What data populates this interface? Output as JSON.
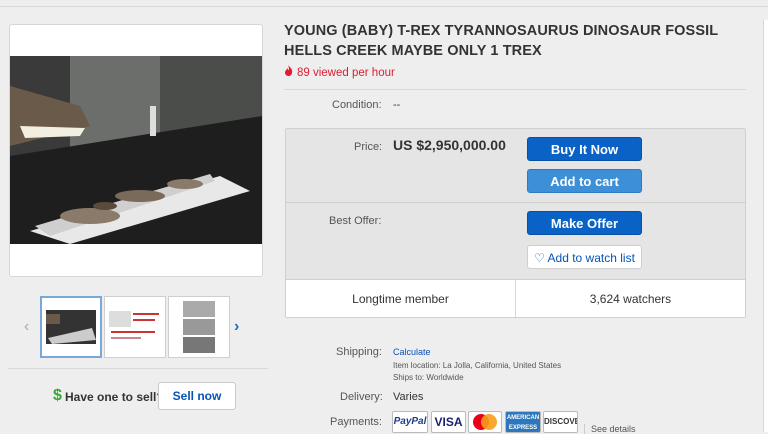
{
  "listing": {
    "title": "YOUNG (BABY) T-REX TYRANNOSAURUS DINOSAUR FOSSIL HELLS CREEK MAYBE ONLY 1 TREX",
    "views": "89 viewed per hour",
    "condition_label": "Condition:",
    "condition_value": "--"
  },
  "price": {
    "label": "Price:",
    "value": "US $2,950,000.00",
    "buy_now": "Buy It Now",
    "add_to_cart": "Add to cart"
  },
  "offer": {
    "label": "Best Offer:",
    "make_offer": "Make Offer",
    "watch": "Add to watch list"
  },
  "seller": {
    "member": "Longtime member",
    "watchers": "3,624 watchers"
  },
  "shipping": {
    "label": "Shipping:",
    "calc": "Calculate",
    "location": "Item location:  La Jolla, California, United States",
    "ships_to": "Ships to:  Worldwide"
  },
  "delivery": {
    "label": "Delivery:",
    "value": "Varies"
  },
  "payments": {
    "label": "Payments:",
    "paypal": "PayPal",
    "visa": "VISA",
    "mastercard": "MasterCard",
    "amex": "AMERICAN EXPRESS",
    "discover": "DISCOVER",
    "see_details": "See details"
  },
  "sell": {
    "question": "Have one to sell?",
    "button": "Sell now",
    "dollar": "$"
  },
  "icons": {
    "fire": "fire-icon",
    "heart": "heart-icon"
  },
  "colors": {
    "views_red": "#dd1e31",
    "primary_blue": "#0b62c6",
    "cart_blue": "#3d8fd8",
    "link_blue": "#0654ba"
  }
}
